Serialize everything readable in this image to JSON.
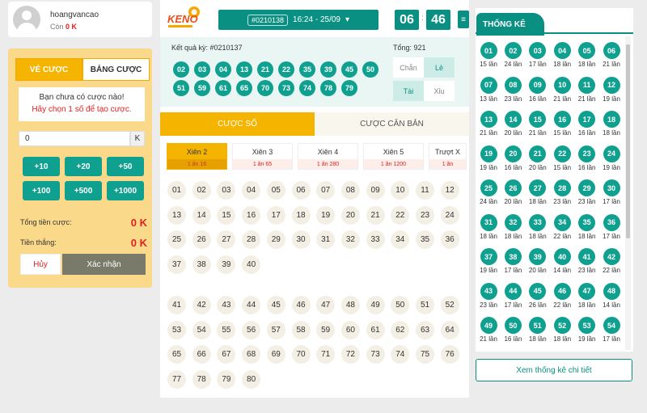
{
  "user": {
    "name": "hoangvancao",
    "balance_label": "Còn",
    "balance": "0 K"
  },
  "left": {
    "tabs": [
      "VÉ CƯỢC",
      "BẢNG CƯỢC"
    ],
    "notice_line1": "Bạn chưa có cược nào!",
    "notice_line2": "Hãy chọn 1 số để tạo cược.",
    "amount": "0",
    "amount_unit": "K",
    "quick": [
      "+10",
      "+20",
      "+50",
      "+100",
      "+500",
      "+1000"
    ],
    "total_label": "Tổng tiền cược:",
    "total_value": "0 K",
    "win_label": "Tiền thắng:",
    "win_value": "0 K",
    "cancel": "Hủy",
    "confirm": "Xác nhận"
  },
  "header": {
    "logo": "KENO",
    "round_id": "#0210138",
    "round_time": "16:24 - 25/09",
    "timer_min": "06",
    "timer_sec": "46",
    "timer_sep": ":"
  },
  "result": {
    "label": "Kết quả kỳ: #0210137",
    "balls": [
      "02",
      "03",
      "04",
      "13",
      "21",
      "22",
      "35",
      "39",
      "45",
      "50",
      "51",
      "59",
      "61",
      "65",
      "70",
      "73",
      "74",
      "78",
      "79"
    ],
    "total": "Tổng: 921",
    "chan": "Chẵn",
    "le": "Lẻ",
    "tai": "Tài",
    "xiu": "Xỉu"
  },
  "bet_tabs": [
    "CƯỢC SỐ",
    "CƯỢC CĂN BẢN"
  ],
  "xien": [
    {
      "name": "Xiên 2",
      "rate": "1 ăn 16"
    },
    {
      "name": "Xiên 3",
      "rate": "1 ăn 65"
    },
    {
      "name": "Xiên 4",
      "rate": "1 ăn 280"
    },
    {
      "name": "Xiên 5",
      "rate": "1 ăn 1200"
    },
    {
      "name": "Trượt X",
      "rate": "1 ăn"
    }
  ],
  "stats": {
    "title": "THỐNG KÊ",
    "detail_button": "Xem thống kê chi tiết",
    "items": [
      [
        "01",
        "15 lần"
      ],
      [
        "02",
        "24 lần"
      ],
      [
        "03",
        "17 lần"
      ],
      [
        "04",
        "18 lần"
      ],
      [
        "05",
        "18 lần"
      ],
      [
        "06",
        "21 lần"
      ],
      [
        "07",
        "13 lần"
      ],
      [
        "08",
        "23 lần"
      ],
      [
        "09",
        "16 lần"
      ],
      [
        "10",
        "21 lần"
      ],
      [
        "11",
        "21 lần"
      ],
      [
        "12",
        "19 lần"
      ],
      [
        "13",
        "21 lần"
      ],
      [
        "14",
        "20 lần"
      ],
      [
        "15",
        "21 lần"
      ],
      [
        "16",
        "15 lần"
      ],
      [
        "17",
        "16 lần"
      ],
      [
        "18",
        "18 lần"
      ],
      [
        "19",
        "19 lần"
      ],
      [
        "20",
        "16 lần"
      ],
      [
        "21",
        "20 lần"
      ],
      [
        "22",
        "15 lần"
      ],
      [
        "23",
        "16 lần"
      ],
      [
        "24",
        "19 lần"
      ],
      [
        "25",
        "24 lần"
      ],
      [
        "26",
        "20 lần"
      ],
      [
        "27",
        "18 lần"
      ],
      [
        "28",
        "23 lần"
      ],
      [
        "29",
        "23 lần"
      ],
      [
        "30",
        "17 lần"
      ],
      [
        "31",
        "18 lần"
      ],
      [
        "32",
        "18 lần"
      ],
      [
        "33",
        "18 lần"
      ],
      [
        "34",
        "22 lần"
      ],
      [
        "35",
        "18 lần"
      ],
      [
        "36",
        "17 lần"
      ],
      [
        "37",
        "19 lần"
      ],
      [
        "38",
        "17 lần"
      ],
      [
        "39",
        "20 lần"
      ],
      [
        "40",
        "14 lần"
      ],
      [
        "41",
        "23 lần"
      ],
      [
        "42",
        "22 lần"
      ],
      [
        "43",
        "23 lần"
      ],
      [
        "44",
        "17 lần"
      ],
      [
        "45",
        "26 lần"
      ],
      [
        "46",
        "22 lần"
      ],
      [
        "47",
        "18 lần"
      ],
      [
        "48",
        "14 lần"
      ],
      [
        "49",
        "21 lần"
      ],
      [
        "50",
        "16 lần"
      ],
      [
        "51",
        "18 lần"
      ],
      [
        "52",
        "18 lần"
      ],
      [
        "53",
        "19 lần"
      ],
      [
        "54",
        "17 lần"
      ]
    ]
  }
}
